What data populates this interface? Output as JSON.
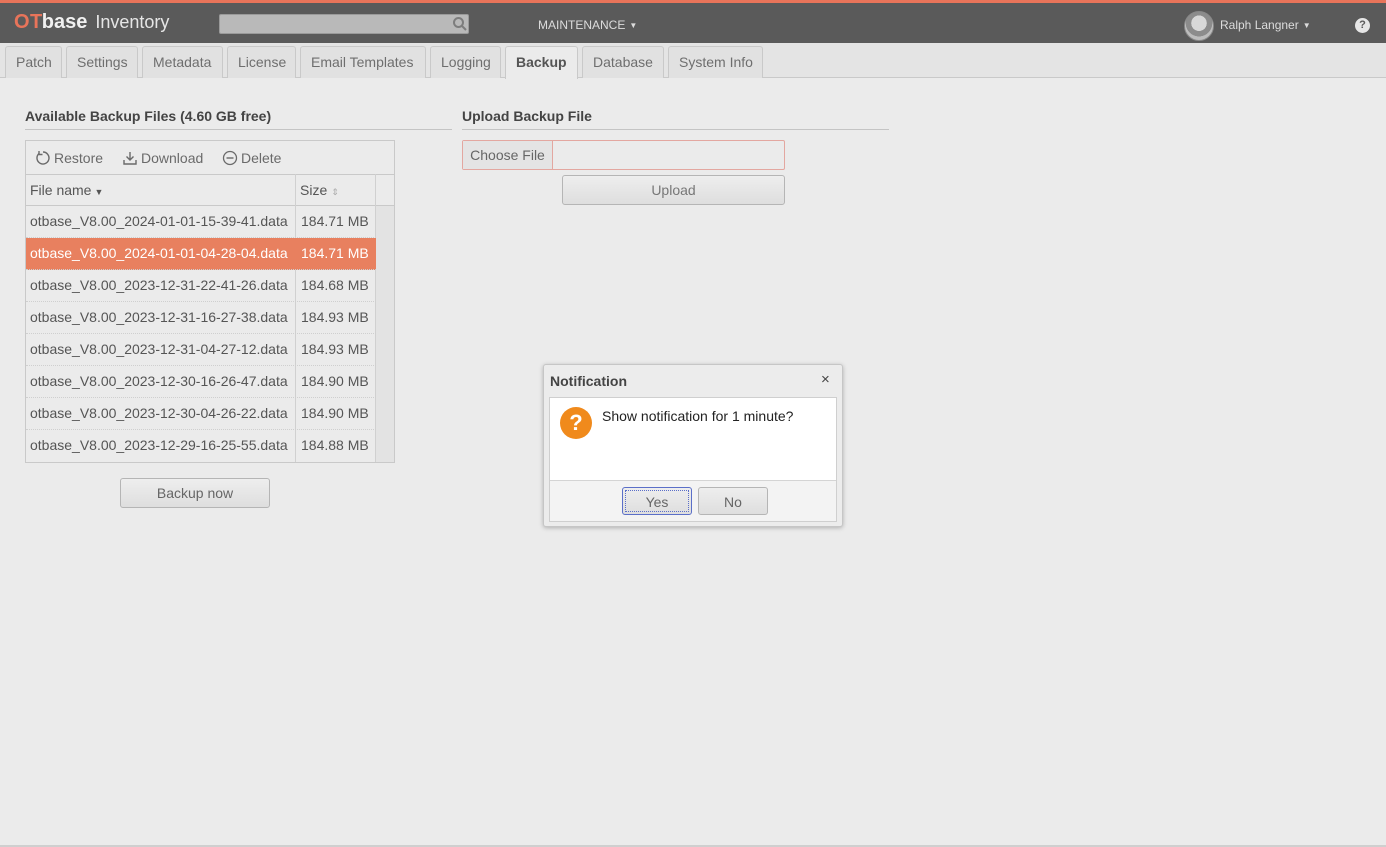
{
  "header": {
    "logo_ot": "OT",
    "logo_base": "base",
    "logo_product": "Inventory",
    "search_placeholder": "",
    "menu_maintenance": "MAINTENANCE",
    "user_name": "Ralph Langner",
    "help_label": "?",
    "accent_color": "#e8745a"
  },
  "tabs": [
    {
      "label": "Patch"
    },
    {
      "label": "Settings"
    },
    {
      "label": "Metadata"
    },
    {
      "label": "License"
    },
    {
      "label": "Email Templates"
    },
    {
      "label": "Logging"
    },
    {
      "label": "Backup",
      "active": true
    },
    {
      "label": "Database"
    },
    {
      "label": "System Info"
    }
  ],
  "backup": {
    "title": "Available Backup Files (4.60 GB free)",
    "toolbar": {
      "restore": "Restore",
      "download": "Download",
      "delete": "Delete"
    },
    "columns": {
      "file_name": "File name",
      "size": "Size"
    },
    "rows": [
      {
        "file": "otbase_V8.00_2024-01-01-15-39-41.data",
        "size": "184.71 MB"
      },
      {
        "file": "otbase_V8.00_2024-01-01-04-28-04.data",
        "size": "184.71 MB",
        "selected": true
      },
      {
        "file": "otbase_V8.00_2023-12-31-22-41-26.data",
        "size": "184.68 MB"
      },
      {
        "file": "otbase_V8.00_2023-12-31-16-27-38.data",
        "size": "184.93 MB"
      },
      {
        "file": "otbase_V8.00_2023-12-31-04-27-12.data",
        "size": "184.93 MB"
      },
      {
        "file": "otbase_V8.00_2023-12-30-16-26-47.data",
        "size": "184.90 MB"
      },
      {
        "file": "otbase_V8.00_2023-12-30-04-26-22.data",
        "size": "184.90 MB"
      },
      {
        "file": "otbase_V8.00_2023-12-29-16-25-55.data",
        "size": "184.88 MB"
      }
    ],
    "backup_now": "Backup now",
    "selected_color": "#e8805f"
  },
  "upload": {
    "title": "Upload Backup File",
    "choose_file": "Choose File",
    "upload_button": "Upload"
  },
  "dialog": {
    "title": "Notification",
    "close": "×",
    "icon": "question-icon",
    "message": "Show notification for 1 minute?",
    "yes": "Yes",
    "no": "No"
  }
}
